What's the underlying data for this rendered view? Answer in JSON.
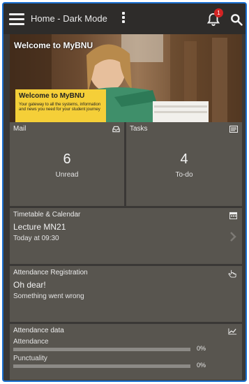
{
  "header": {
    "title": "Home - Dark Mode",
    "notification_count": "1",
    "icons": [
      "menu-icon",
      "more-vert-icon",
      "bell-icon",
      "search-icon"
    ]
  },
  "hero": {
    "title": "Welcome to MyBNU",
    "card_title": "Welcome to MyBNU",
    "card_text": "Your gateway to all the systems, information and news you need for your student journey"
  },
  "mail": {
    "label": "Mail",
    "count": "6",
    "sub": "Unread",
    "icon": "inbox-icon"
  },
  "tasks": {
    "label": "Tasks",
    "count": "4",
    "sub": "To-do",
    "icon": "tasks-icon"
  },
  "timetable": {
    "label": "Timetable & Calendar",
    "event": "Lecture MN21",
    "time": "Today at 09:30",
    "icon": "calendar-icon"
  },
  "attendance_registration": {
    "label": "Attendance Registration",
    "heading": "Oh dear!",
    "message": "Something went wrong",
    "icon": "hand-pointer-icon"
  },
  "attendance_data": {
    "label": "Attendance data",
    "icon": "chart-line-icon",
    "metrics": [
      {
        "name": "Attendance",
        "value_text": "0%",
        "fraction": 0
      },
      {
        "name": "Punctuality",
        "value_text": "0%",
        "fraction": 0
      }
    ]
  },
  "colors": {
    "header_bg": "#2e2c2a",
    "tile_bg": "#58554f",
    "accent_yellow": "#f5cf38",
    "badge_red": "#d32323",
    "frame_border": "#1a6fd0"
  }
}
